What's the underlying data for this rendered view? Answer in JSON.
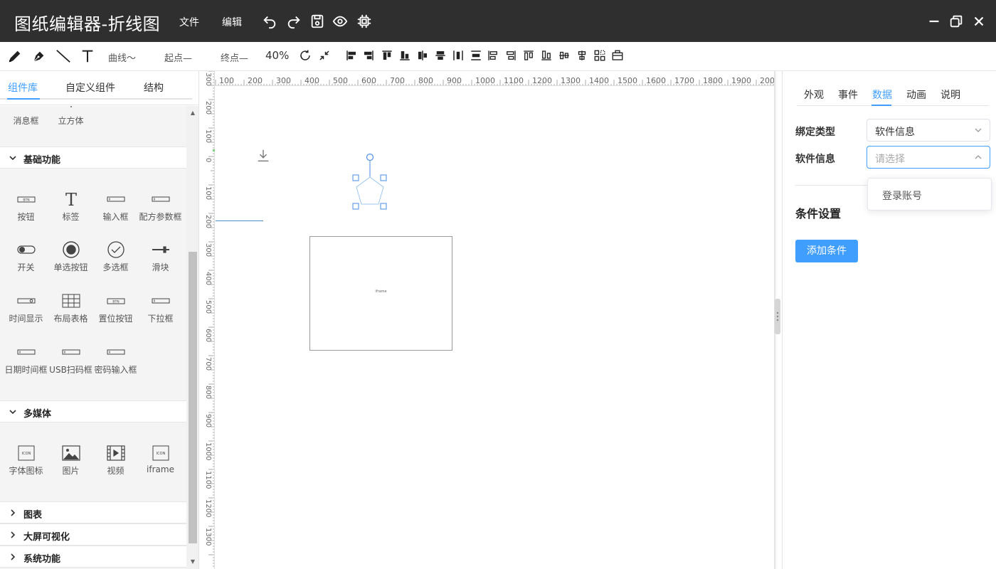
{
  "window": {
    "title": "图纸编辑器-折线图",
    "menu": [
      "文件",
      "编辑"
    ]
  },
  "toolbar": {
    "curve_label": "曲线〜",
    "start_label": "起点—",
    "end_label": "终点—",
    "zoom": "40%"
  },
  "left_panel": {
    "tabs": [
      "组件库",
      "自定义组件",
      "结构"
    ],
    "active_tab": "组件库",
    "partial_items": [
      "消息框",
      "立方体"
    ],
    "sections": [
      {
        "title": "基础功能",
        "expanded": true,
        "items": [
          "按钮",
          "标签",
          "输入框",
          "配方参数框",
          "开关",
          "单选按钮",
          "多选框",
          "滑块",
          "时间显示",
          "布局表格",
          "置位按钮",
          "下拉框",
          "日期时间框",
          "USB扫码框",
          "密码输入框"
        ]
      },
      {
        "title": "多媒体",
        "expanded": true,
        "items": [
          "字体图标",
          "图片",
          "视频",
          "iframe"
        ]
      },
      {
        "title": "图表",
        "expanded": false,
        "items": []
      },
      {
        "title": "大屏可视化",
        "expanded": false,
        "items": []
      },
      {
        "title": "系统功能",
        "expanded": false,
        "items": []
      }
    ]
  },
  "canvas": {
    "ruler_top": [
      "300",
      "100",
      "200",
      "300",
      "400",
      "500",
      "600",
      "700",
      "800",
      "900",
      "1000",
      "1100",
      "1200",
      "1300",
      "1400",
      "1500",
      "1600",
      "1700",
      "1800",
      "1900",
      "200"
    ],
    "ruler_left": [
      "300",
      "200",
      "100",
      "0",
      "100",
      "200",
      "300",
      "400",
      "500",
      "600",
      "700",
      "800",
      "900",
      "1000",
      "1100",
      "1200",
      "1300"
    ],
    "iframe_label": "iframe"
  },
  "right_panel": {
    "tabs": [
      "外观",
      "事件",
      "数据",
      "动画",
      "说明"
    ],
    "active_tab": "数据",
    "binding_type_label": "绑定类型",
    "binding_type_value": "软件信息",
    "software_info_label": "软件信息",
    "software_info_placeholder": "请选择",
    "dropdown_options": [
      "登录账号"
    ],
    "condition_title": "条件设置",
    "add_condition_button": "添加条件"
  },
  "colors": {
    "accent": "#409eff",
    "titlebar": "#2f2f2f"
  }
}
